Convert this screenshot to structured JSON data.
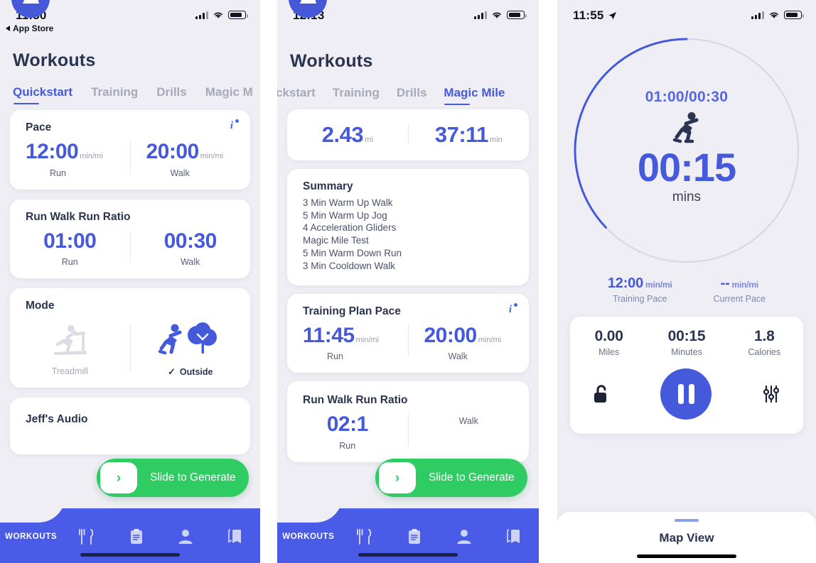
{
  "accent": {
    "blue": "#4559db",
    "nav_blue": "#4a5be8",
    "green": "#2ecc62",
    "dark_navy": "#2b3450",
    "bg": "#eeeef4"
  },
  "screen1": {
    "status": {
      "time": "11:50",
      "back_label": "App Store",
      "signal_icon": "cellular-bars-icon",
      "wifi_icon": "wifi-icon",
      "battery_icon": "battery-icon"
    },
    "title": "Workouts",
    "tabs": [
      {
        "label": "Quickstart",
        "active": true
      },
      {
        "label": "Training",
        "active": false
      },
      {
        "label": "Drills",
        "active": false
      },
      {
        "label": "Magic M",
        "active": false
      }
    ],
    "pace_card": {
      "title": "Pace",
      "info_icon": "info-icon",
      "run_value": "12:00",
      "run_unit": "min/mi",
      "run_label": "Run",
      "walk_value": "20:00",
      "walk_unit": "min/mi",
      "walk_label": "Walk"
    },
    "ratio_card": {
      "title": "Run Walk Run Ratio",
      "run_value": "01:00",
      "run_label": "Run",
      "walk_value": "00:30",
      "walk_label": "Walk"
    },
    "mode_card": {
      "title": "Mode",
      "treadmill_label": "Treadmill",
      "treadmill_icon": "treadmill-icon",
      "outside_label": "Outside",
      "outside_icon": "runner-outside-icon",
      "outside_check": "✓"
    },
    "audio_card": {
      "title": "Jeff's Audio"
    },
    "slider": {
      "label": "Slide to Generate",
      "knob_icon": "chevron-right-icon"
    },
    "nav": {
      "fab_icon": "running-shoe-icon",
      "label": "WORKOUTS",
      "items": [
        {
          "icon": "fork-knife-icon"
        },
        {
          "icon": "clipboard-icon"
        },
        {
          "icon": "person-icon"
        },
        {
          "icon": "book-icon"
        }
      ]
    }
  },
  "screen2": {
    "status": {
      "time": "12:13",
      "signal_icon": "cellular-bars-icon",
      "wifi_icon": "wifi-icon",
      "battery_icon": "battery-icon"
    },
    "title": "Workouts",
    "tabs": [
      {
        "label": "ckstart",
        "active": false
      },
      {
        "label": "Training",
        "active": false
      },
      {
        "label": "Drills",
        "active": false
      },
      {
        "label": "Magic Mile",
        "active": true
      }
    ],
    "magic_stats": {
      "distance_value": "2.43",
      "distance_unit": "mi",
      "time_value": "37:11",
      "time_unit": "min"
    },
    "summary_card": {
      "title": "Summary",
      "items": [
        "3 Min Warm Up Walk",
        "5 Min Warm Up Jog",
        "4 Acceleration Gliders",
        "Magic Mile Test",
        "5 Min Warm Down Run",
        "3 Min Cooldown Walk"
      ]
    },
    "training_pace_card": {
      "title": "Training Plan Pace",
      "info_icon": "info-icon",
      "run_value": "11:45",
      "run_unit": "min/mi",
      "run_label": "Run",
      "walk_value": "20:00",
      "walk_unit": "min/mi",
      "walk_label": "Walk"
    },
    "ratio_card": {
      "title": "Run Walk Run Ratio",
      "run_value": "02:1",
      "run_label": "Run",
      "walk_value": "",
      "walk_label": "Walk"
    },
    "slider": {
      "label": "Slide to Generate",
      "knob_icon": "chevron-right-icon"
    },
    "nav": {
      "fab_icon": "running-shoe-icon",
      "label": "WORKOUTS",
      "items": [
        {
          "icon": "fork-knife-icon"
        },
        {
          "icon": "clipboard-icon"
        },
        {
          "icon": "person-icon"
        },
        {
          "icon": "book-icon"
        }
      ]
    }
  },
  "screen3": {
    "status": {
      "time": "11:55",
      "location_icon": "location-arrow-icon",
      "signal_icon": "cellular-bars-icon",
      "wifi_icon": "wifi-icon",
      "battery_icon": "battery-icon"
    },
    "timer": {
      "interval": "01:00/00:30",
      "runner_icon": "runner-icon",
      "value": "00:15",
      "unit": "mins",
      "progress_percent": 25
    },
    "paces": [
      {
        "value": "12:00",
        "unit": "min/mi",
        "label": "Training Pace"
      },
      {
        "value": "--",
        "unit": "min/mi",
        "label": "Current Pace"
      }
    ],
    "stats": [
      {
        "value": "0.00",
        "label": "Miles"
      },
      {
        "value": "00:15",
        "label": "Minutes"
      },
      {
        "value": "1.8",
        "label": "Calories"
      }
    ],
    "controls": {
      "lock_icon": "unlocked-padlock-icon",
      "pause_icon": "pause-icon",
      "settings_icon": "sliders-icon"
    },
    "map_view": {
      "label": "Map View",
      "grabber": "drag-handle"
    }
  }
}
